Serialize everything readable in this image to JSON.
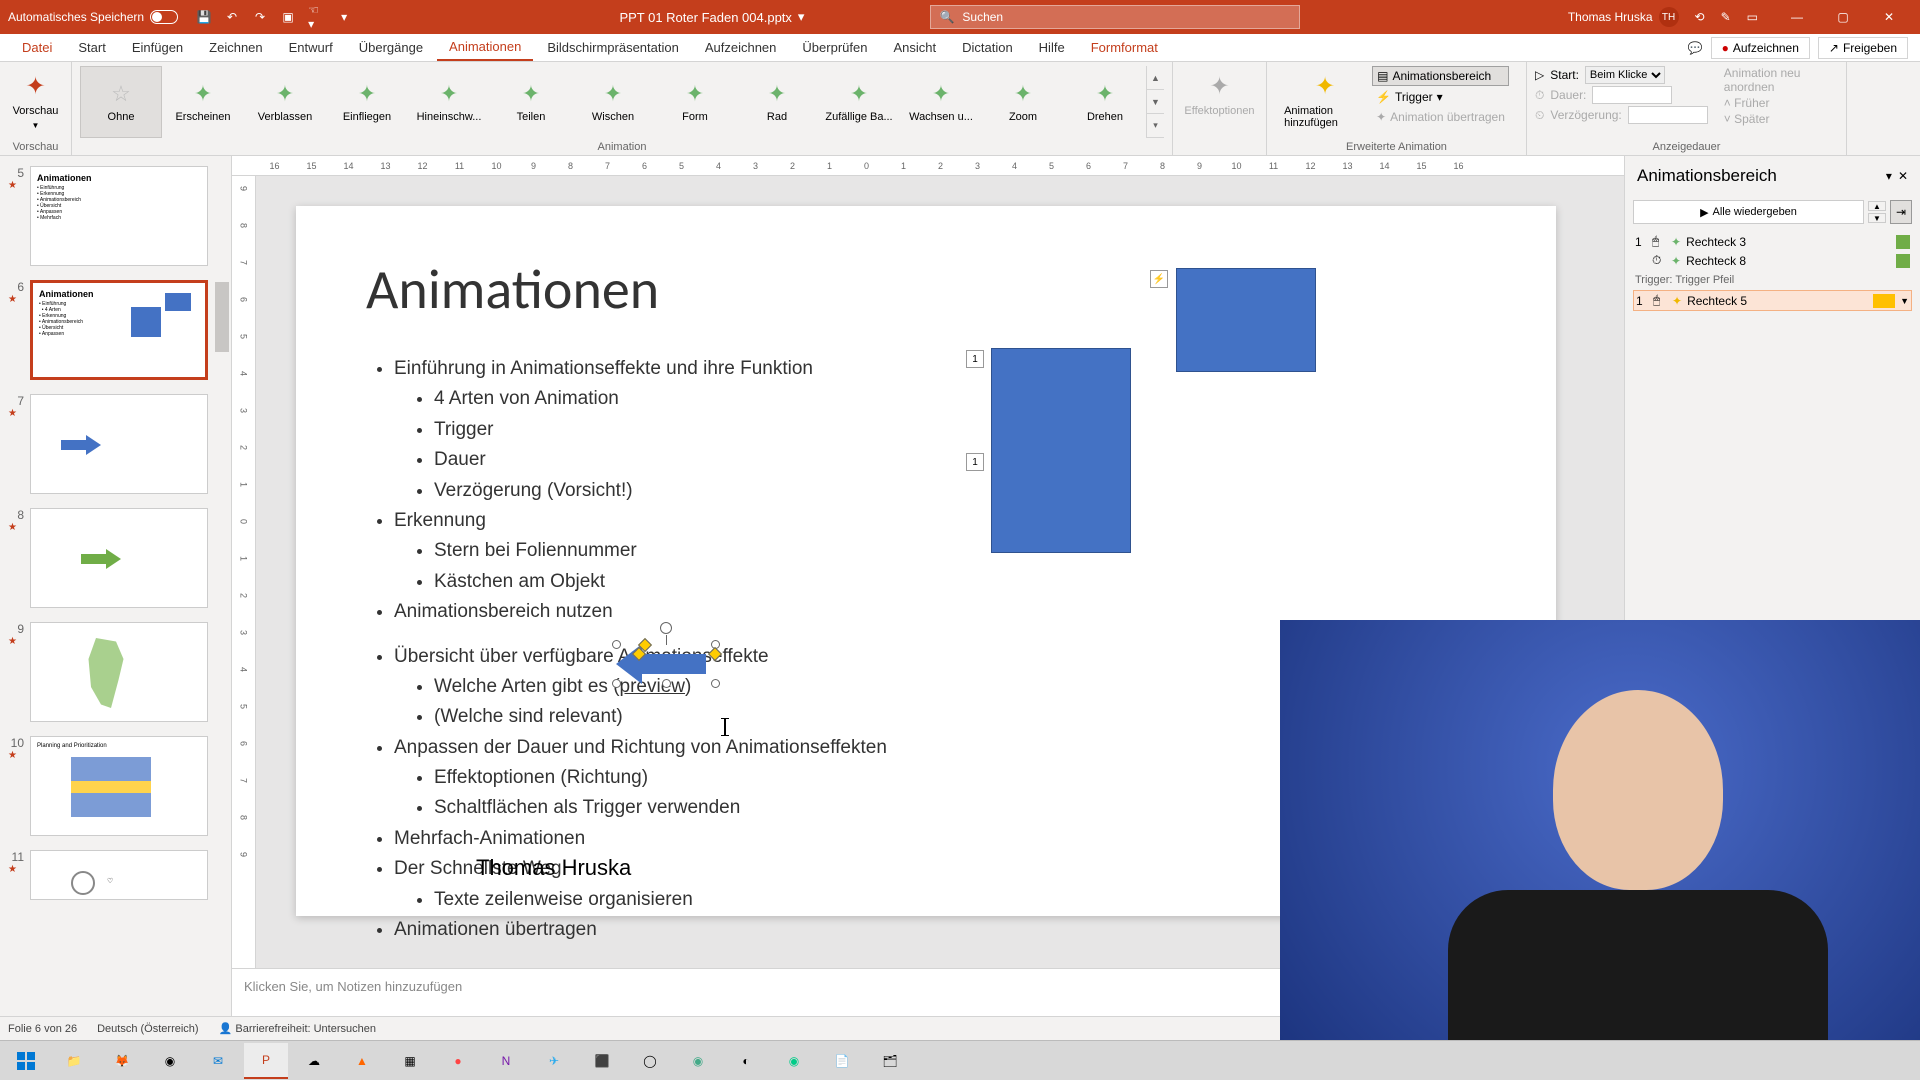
{
  "titlebar": {
    "autosave": "Automatisches Speichern",
    "filename": "PPT 01 Roter Faden 004.pptx",
    "search_placeholder": "Suchen",
    "user_name": "Thomas Hruska",
    "user_initials": "TH"
  },
  "tabs": {
    "file": "Datei",
    "start": "Start",
    "insert": "Einfügen",
    "draw": "Zeichnen",
    "design": "Entwurf",
    "transitions": "Übergänge",
    "animations": "Animationen",
    "slideshow": "Bildschirmpräsentation",
    "record_tab": "Aufzeichnen",
    "review": "Überprüfen",
    "view": "Ansicht",
    "dictation": "Dictation",
    "help": "Hilfe",
    "shapeformat": "Formformat",
    "record": "Aufzeichnen",
    "share": "Freigeben"
  },
  "ribbon": {
    "preview": "Vorschau",
    "preview_group": "Vorschau",
    "gallery": {
      "none": "Ohne",
      "appear": "Erscheinen",
      "fade": "Verblassen",
      "flyin": "Einfliegen",
      "floatin": "Hineinschw...",
      "split": "Teilen",
      "wipe": "Wischen",
      "shape": "Form",
      "wheel": "Rad",
      "random": "Zufällige Ba...",
      "grow": "Wachsen u...",
      "zoom": "Zoom",
      "swivel": "Drehen"
    },
    "animation_group": "Animation",
    "effect_options": "Effektoptionen",
    "add_animation": "Animation hinzufügen",
    "anim_pane_btn": "Animationsbereich",
    "trigger": "Trigger",
    "anim_painter": "Animation übertragen",
    "ext_anim_group": "Erweiterte Animation",
    "start_label": "Start:",
    "start_value": "Beim Klicken",
    "duration_label": "Dauer:",
    "delay_label": "Verzögerung:",
    "reorder_label": "Animation neu anordnen",
    "earlier": "Früher",
    "later": "Später",
    "timing_group": "Anzeigedauer"
  },
  "slide": {
    "title": "Animationen",
    "b1": "Einführung in Animationseffekte und ihre Funktion",
    "b1a": "4 Arten von Animation",
    "b1b": "Trigger",
    "b1c": "Dauer",
    "b1d": "Verzögerung (Vorsicht!)",
    "b2": "Erkennung",
    "b2a": "Stern bei Foliennummer",
    "b2b": "Kästchen am Objekt",
    "b3": "Animationsbereich nutzen",
    "b4": "Übersicht über verfügbare Animationseffekte",
    "b4a_pre": "Welche Arten gibt es (",
    "b4a_link": "preview",
    "b4a_post": ")",
    "b4b": "(Welche sind relevant)",
    "b5": "Anpassen der Dauer und Richtung von Animationseffekten",
    "b5a": "Effektoptionen (Richtung)",
    "b5b": "Schaltflächen als Trigger verwenden",
    "b6": "Mehrfach-Animationen",
    "b7": "Der Schnellste Weg",
    "b7a": "Texte zeilenweise organisieren",
    "b8": "Animationen übertragen",
    "author": "Thomas Hruska",
    "tag1": "1",
    "tag2": "1",
    "tag_bolt": "⚡"
  },
  "thumbs": {
    "n5": "5",
    "n6": "6",
    "n7": "7",
    "n8": "8",
    "n9": "9",
    "n10": "10",
    "n11": "11",
    "t6_title": "Animationen"
  },
  "anim_pane": {
    "title": "Animationsbereich",
    "play_all": "Alle wiedergeben",
    "item1_num": "1",
    "item1_name": "Rechteck 3",
    "item2_name": "Rechteck 8",
    "trigger_label": "Trigger: Trigger Pfeil",
    "item3_num": "1",
    "item3_name": "Rechteck 5"
  },
  "notes": {
    "placeholder": "Klicken Sie, um Notizen hinzuzufügen"
  },
  "statusbar": {
    "slide": "Folie 6 von 26",
    "lang": "Deutsch (Österreich)",
    "access": "Barrierefreiheit: Untersuchen"
  },
  "ruler_h": [
    "16",
    "15",
    "14",
    "13",
    "12",
    "11",
    "10",
    "9",
    "8",
    "7",
    "6",
    "5",
    "4",
    "3",
    "2",
    "1",
    "0",
    "1",
    "2",
    "3",
    "4",
    "5",
    "6",
    "7",
    "8",
    "9",
    "10",
    "11",
    "12",
    "13",
    "14",
    "15",
    "16"
  ],
  "ruler_v": [
    "9",
    "8",
    "7",
    "6",
    "5",
    "4",
    "3",
    "2",
    "1",
    "0",
    "1",
    "2",
    "3",
    "4",
    "5",
    "6",
    "7",
    "8",
    "9"
  ]
}
